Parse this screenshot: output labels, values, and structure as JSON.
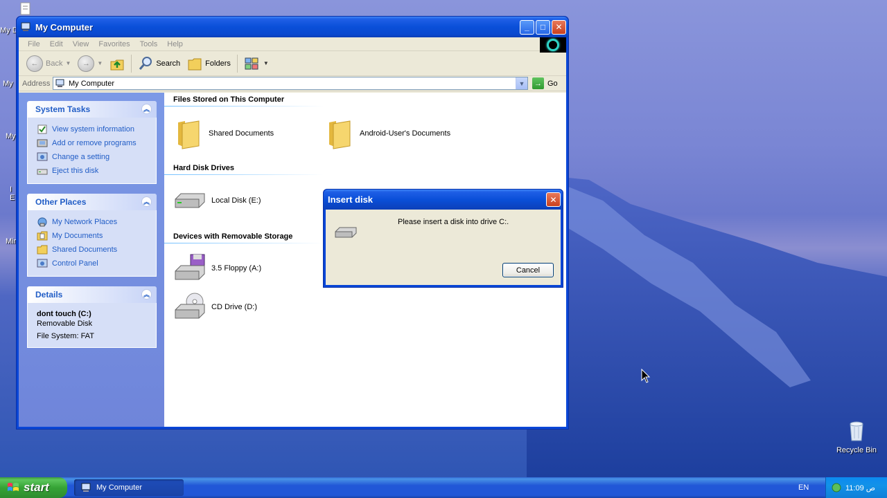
{
  "desktop": {
    "partial_icon_labels": [
      "My D",
      "My",
      "My",
      "I E",
      "Mir"
    ],
    "recycle_bin_label": "Recycle Bin"
  },
  "window": {
    "title": "My Computer",
    "menu": [
      "File",
      "Edit",
      "View",
      "Favorites",
      "Tools",
      "Help"
    ],
    "toolbar": {
      "back_label": "Back",
      "search_label": "Search",
      "folders_label": "Folders"
    },
    "address": {
      "label": "Address",
      "value": "My Computer",
      "go_label": "Go"
    }
  },
  "sidebar": {
    "system_tasks": {
      "title": "System Tasks",
      "items": [
        "View system information",
        "Add or remove programs",
        "Change a setting",
        "Eject this disk"
      ]
    },
    "other_places": {
      "title": "Other Places",
      "items": [
        "My Network Places",
        "My Documents",
        "Shared Documents",
        "Control Panel"
      ]
    },
    "details": {
      "title": "Details",
      "name": "dont touch (C:)",
      "type": "Removable Disk",
      "filesystem": "File System: FAT"
    }
  },
  "main": {
    "groups": {
      "files_stored": "Files Stored on This Computer",
      "hard_disks": "Hard Disk Drives",
      "removable": "Devices with Removable Storage"
    },
    "items": {
      "shared_docs": "Shared Documents",
      "android_docs": "Android-User's Documents",
      "local_disk": "Local Disk (E:)",
      "floppy": "3.5 Floppy (A:)",
      "cd_drive": "CD Drive (D:)"
    }
  },
  "dialog": {
    "title": "Insert disk",
    "message": "Please insert a disk into drive C:.",
    "cancel_label": "Cancel"
  },
  "taskbar": {
    "start_label": "start",
    "task_label": "My Computer",
    "language": "EN",
    "clock": "11:09 ص"
  },
  "colors": {
    "title_blue": "#0a4fd8",
    "link_blue": "#215dc6",
    "start_green": "#36a336"
  }
}
